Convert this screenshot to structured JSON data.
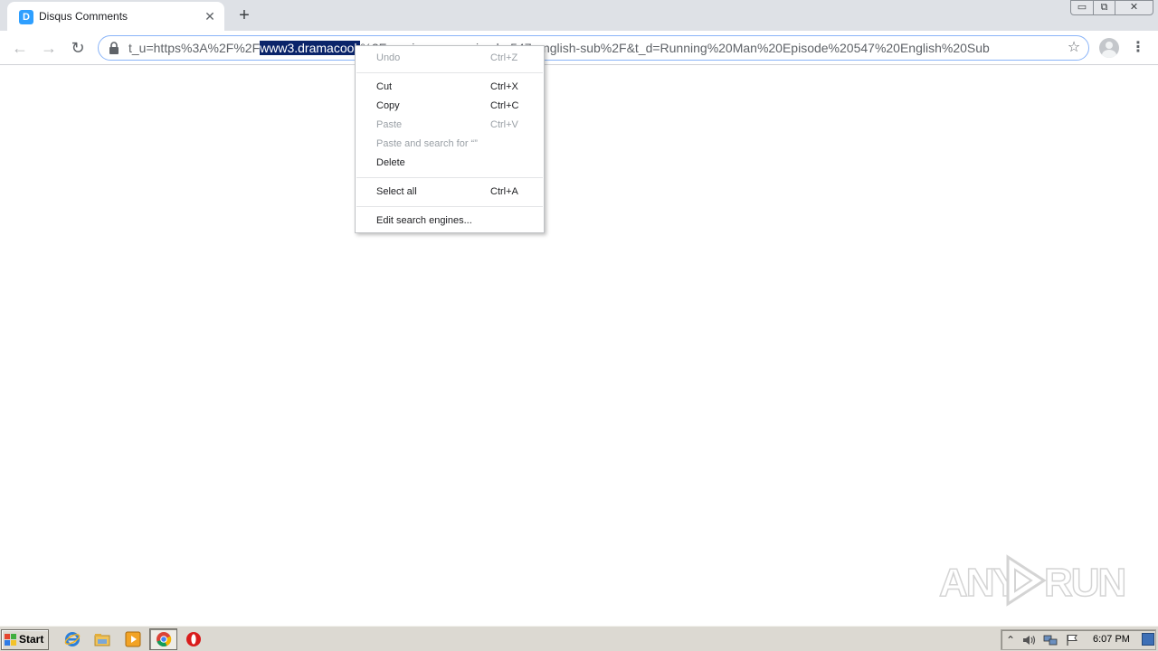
{
  "browser": {
    "tab": {
      "title": "Disqus Comments",
      "favicon_letter": "D",
      "close_glyph": "✕"
    },
    "new_tab_glyph": "+",
    "window_controls": {
      "minimize": "▭",
      "maximize": "⧉",
      "close": "✕"
    },
    "toolbar": {
      "back_glyph": "←",
      "forward_glyph": "→",
      "reload_glyph": "↻",
      "url_before": "t_u=https%3A%2F%2F",
      "url_selected": "www3.dramacool.",
      "url_after": "%2Frunning-man-episode-547-english-sub%2F&t_d=Running%20Man%20Episode%20547%20English%20Sub",
      "star_glyph": "☆",
      "menu_glyph": "⋮"
    }
  },
  "context_menu": {
    "items": [
      {
        "label": "Undo",
        "shortcut": "Ctrl+Z",
        "disabled": true
      },
      {
        "label": "Cut",
        "shortcut": "Ctrl+X",
        "disabled": false
      },
      {
        "label": "Copy",
        "shortcut": "Ctrl+C",
        "disabled": false
      },
      {
        "label": "Paste",
        "shortcut": "Ctrl+V",
        "disabled": true
      },
      {
        "label": "Paste and search for “”",
        "shortcut": "",
        "disabled": true
      },
      {
        "label": "Delete",
        "shortcut": "",
        "disabled": false
      },
      {
        "label": "Select all",
        "shortcut": "Ctrl+A",
        "disabled": false
      },
      {
        "label": "Edit search engines...",
        "shortcut": "",
        "disabled": false
      }
    ]
  },
  "watermark": {
    "left": "ANY",
    "right": "RUN"
  },
  "taskbar": {
    "start_label": "Start",
    "pinned": [
      "internet-explorer-icon",
      "file-explorer-icon",
      "media-player-icon",
      "chrome-icon",
      "opera-icon"
    ],
    "tray": {
      "expand_glyph": "⌃",
      "clock": "6:07 PM"
    }
  },
  "colors": {
    "selection": "#0a246a",
    "tab_strip": "#dee1e6",
    "taskbar": "#dcd9d2",
    "favicon": "#2e9fff"
  }
}
